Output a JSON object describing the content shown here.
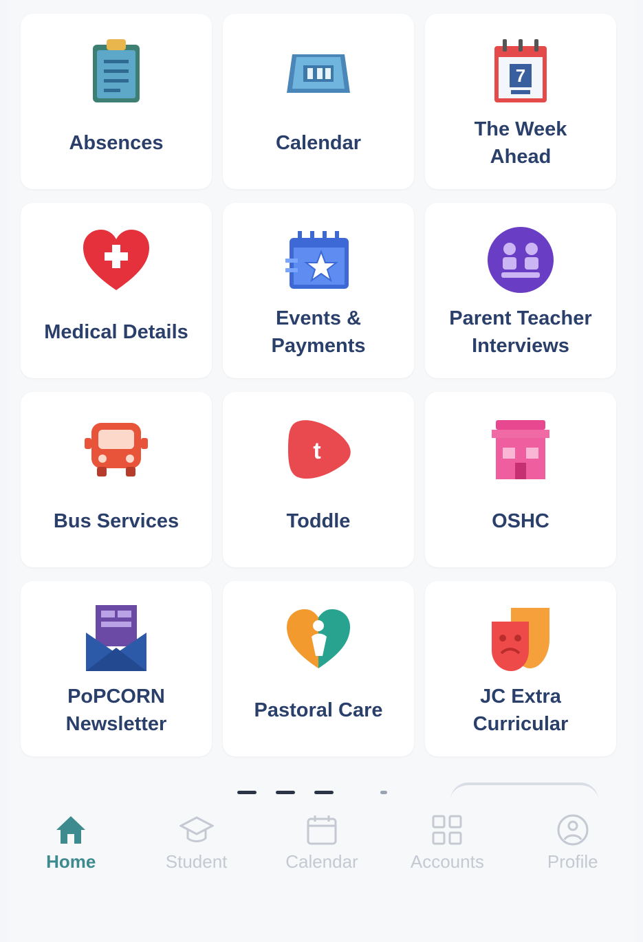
{
  "tiles": [
    {
      "label": "Absences",
      "icon": "clipboard-icon"
    },
    {
      "label": "Calendar",
      "icon": "calendar-icon"
    },
    {
      "label": "The Week\nAhead",
      "icon": "week-calendar-icon"
    },
    {
      "label": "Medical Details",
      "icon": "heart-cross-icon"
    },
    {
      "label": "Events &\nPayments",
      "icon": "event-star-icon"
    },
    {
      "label": "Parent Teacher\nInterviews",
      "icon": "interview-icon"
    },
    {
      "label": "Bus Services",
      "icon": "bus-icon"
    },
    {
      "label": "Toddle",
      "icon": "toddle-icon"
    },
    {
      "label": "OSHC",
      "icon": "building-icon"
    },
    {
      "label": "PoPCORN\nNewsletter",
      "icon": "newsletter-icon"
    },
    {
      "label": "Pastoral Care",
      "icon": "pastoral-care-icon"
    },
    {
      "label": "JC Extra\nCurricular",
      "icon": "theatre-masks-icon"
    }
  ],
  "tabbar": {
    "items": [
      {
        "label": "Home",
        "icon": "home-icon",
        "active": true
      },
      {
        "label": "Student",
        "icon": "graduation-cap-icon",
        "active": false
      },
      {
        "label": "Calendar",
        "icon": "calendar-tab-icon",
        "active": false
      },
      {
        "label": "Accounts",
        "icon": "grid-icon",
        "active": false
      },
      {
        "label": "Profile",
        "icon": "profile-icon",
        "active": false
      }
    ]
  },
  "colors": {
    "label": "#2b3f6b",
    "active_tab": "#3d8a8f",
    "inactive_tab": "#c4c9d2"
  }
}
